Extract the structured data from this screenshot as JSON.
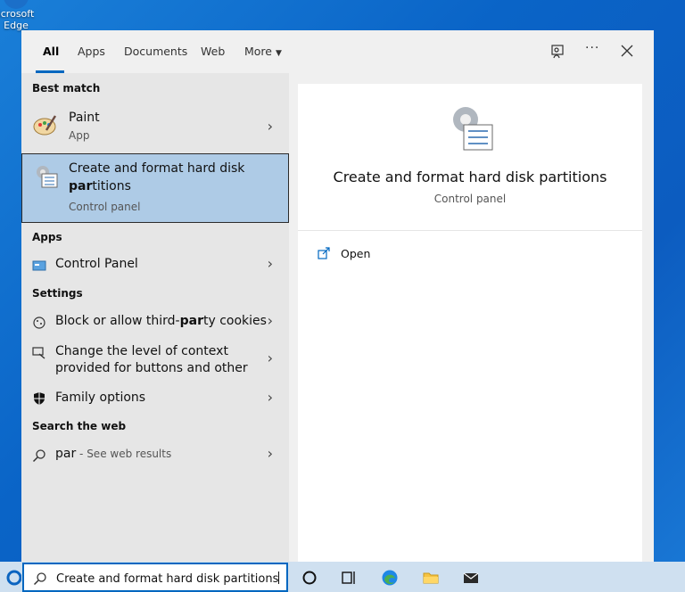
{
  "desktop": {
    "icon_label": "Microsoft Edge",
    "icon_label_visible_line1": "icrosoft",
    "icon_label_visible_line2": "Edge"
  },
  "tabs": [
    {
      "label": "All",
      "active": true
    },
    {
      "label": "Apps"
    },
    {
      "label": "Documents"
    },
    {
      "label": "Web"
    },
    {
      "label": "More"
    }
  ],
  "left": {
    "best_match_header": "Best match",
    "paint": {
      "title": "Paint",
      "sub": "App"
    },
    "selected": {
      "title_line1": "Create and format hard disk",
      "title_line2_prefix": "par",
      "title_line2_rest": "titions",
      "sub": "Control panel"
    },
    "apps_header": "Apps",
    "control_panel": "Control Panel",
    "settings_header": "Settings",
    "cookies": {
      "a": "Block or allow third-",
      "b": "par",
      "c": "ty cookies"
    },
    "context_line1": "Change the level of context",
    "context_line2": "provided for buttons and other",
    "family": "Family options",
    "web_header": "Search the web",
    "web_query": "par",
    "web_hint": " - See web results"
  },
  "right": {
    "title": "Create and format hard disk partitions",
    "sub": "Control panel",
    "open_label": "Open"
  },
  "taskbar": {
    "search_value": "Create and format hard disk partitions"
  },
  "colors": {
    "accent": "#0067c0",
    "selected_bg": "#aecbe6",
    "left_pane": "#e6e6e6"
  }
}
